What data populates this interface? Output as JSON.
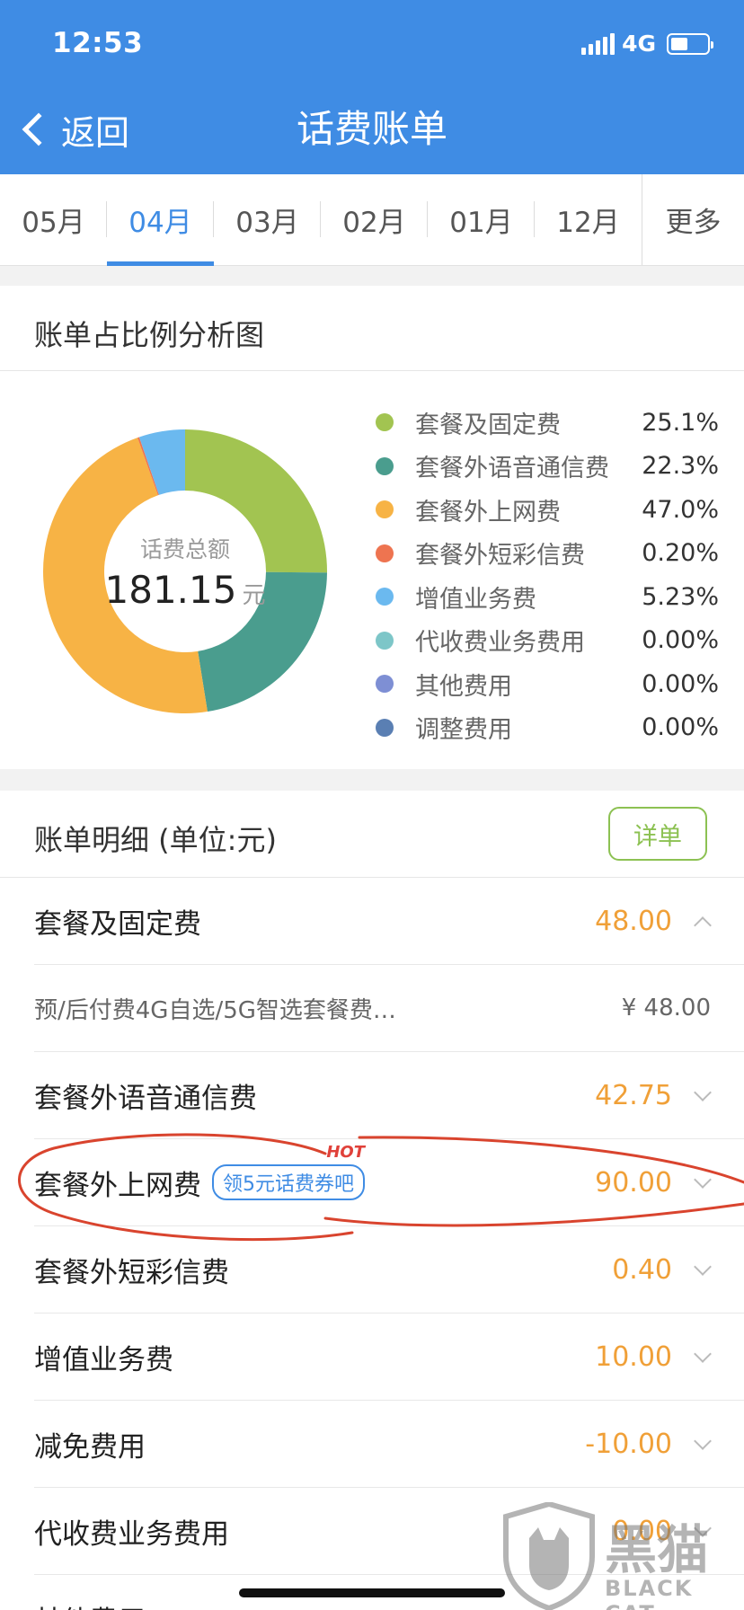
{
  "status_bar": {
    "time": "12:53",
    "network": "4G"
  },
  "nav": {
    "back_label": "返回",
    "title": "话费账单"
  },
  "tabs": [
    {
      "label": "05月",
      "active": false
    },
    {
      "label": "04月",
      "active": true
    },
    {
      "label": "03月",
      "active": false
    },
    {
      "label": "02月",
      "active": false
    },
    {
      "label": "01月",
      "active": false
    },
    {
      "label": "12月",
      "active": false
    },
    {
      "label": "更多",
      "active": false
    }
  ],
  "analysis": {
    "title": "账单占比例分析图",
    "center_label": "话费总额",
    "total": "181.15",
    "unit": "元"
  },
  "chart_data": {
    "type": "pie",
    "donut": true,
    "categories": [
      "套餐及固定费",
      "套餐外语音通信费",
      "套餐外上网费",
      "套餐外短彩信费",
      "增值业务费",
      "代收费业务费用",
      "其他费用",
      "调整费用"
    ],
    "values": [
      25.1,
      22.3,
      47.0,
      0.2,
      5.23,
      0.0,
      0.0,
      0.0
    ],
    "value_labels": [
      "25.1%",
      "22.3%",
      "47.0%",
      "0.20%",
      "5.23%",
      "0.00%",
      "0.00%",
      "0.00%"
    ],
    "colors": [
      "#a2c451",
      "#4a9d8e",
      "#f7b345",
      "#ee7450",
      "#6bb9ef",
      "#7dc6c8",
      "#7e8fd4",
      "#5a7fb3"
    ],
    "legend_position": "right"
  },
  "detail": {
    "title": "账单明细 (单位:元)",
    "detail_button": "详单",
    "rows": [
      {
        "label": "套餐及固定费",
        "amount": "48.00",
        "expanded": true
      },
      {
        "label": "预/后付费4G自选/5G智选套餐费…",
        "amount": "¥ 48.00",
        "is_sub": true
      },
      {
        "label": "套餐外语音通信费",
        "amount": "42.75"
      },
      {
        "label": "套餐外上网费",
        "amount": "90.00",
        "coupon": "领5元话费券吧",
        "coupon_badge": "HOT"
      },
      {
        "label": "套餐外短彩信费",
        "amount": "0.40"
      },
      {
        "label": "增值业务费",
        "amount": "10.00"
      },
      {
        "label": "减免费用",
        "amount": "-10.00"
      },
      {
        "label": "代收费业务费用",
        "amount": "0.00"
      },
      {
        "label": "其他费用",
        "amount": ""
      }
    ]
  },
  "watermark": {
    "text": "黑猫",
    "sub": "BLACK CAT"
  }
}
